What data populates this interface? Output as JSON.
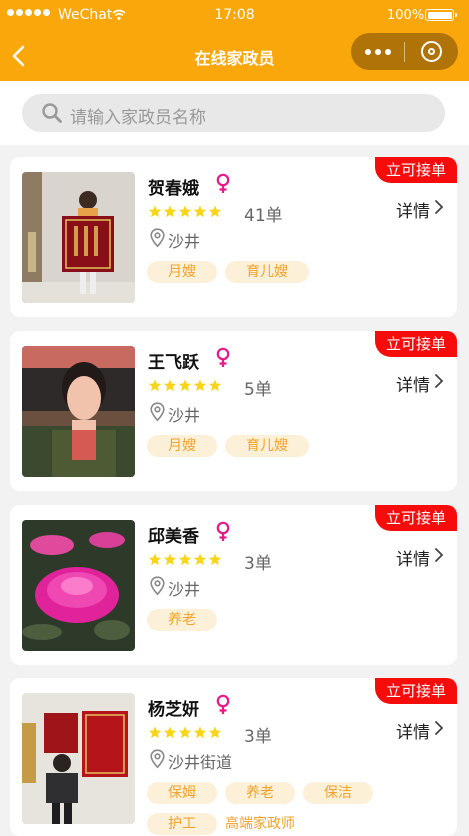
{
  "status_bar": {
    "carrier": "WeChat",
    "time": "17:08",
    "battery": "100%"
  },
  "nav": {
    "title": "在线家政员"
  },
  "search": {
    "placeholder": "请输入家政员名称"
  },
  "colors": {
    "brand": "#f9a70b",
    "badge": "#f70c0c",
    "tag_bg": "#fdf0d8",
    "tag_text": "#f0a22b",
    "star": "#f7d51b",
    "female_icon": "#e8198b"
  },
  "list": {
    "badge_label": "立可接单",
    "detail_label": "详情",
    "items": [
      {
        "name": "贺春娥",
        "rating": 5,
        "orders": "41单",
        "location": "沙井",
        "tags": [
          "月嫂",
          "育儿嫂"
        ]
      },
      {
        "name": "王飞跃",
        "rating": 5,
        "orders": "5单",
        "location": "沙井",
        "tags": [
          "月嫂",
          "育儿嫂"
        ]
      },
      {
        "name": "邱美香",
        "rating": 5,
        "orders": "3单",
        "location": "沙井",
        "tags": [
          "养老"
        ]
      },
      {
        "name": "杨芝妍",
        "rating": 5,
        "orders": "3单",
        "location": "沙井街道",
        "tags": [
          "保姆",
          "养老",
          "保洁",
          "护工",
          "高端家政师"
        ]
      }
    ]
  }
}
